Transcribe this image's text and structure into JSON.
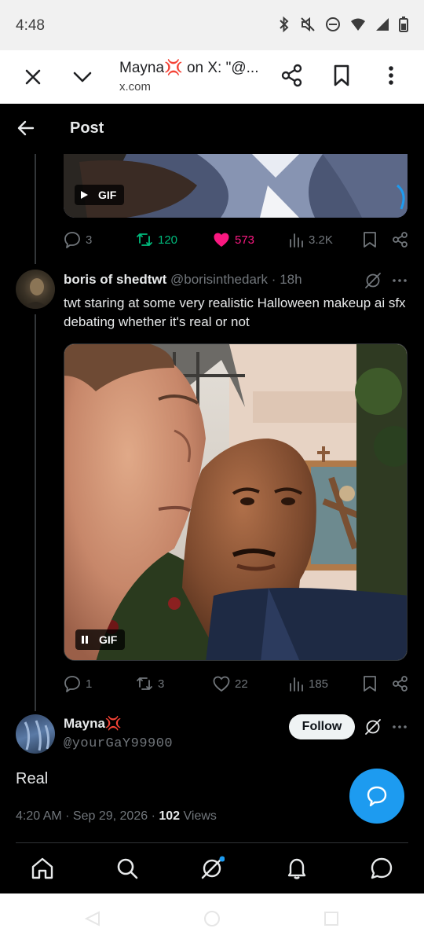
{
  "status_bar": {
    "time": "4:48"
  },
  "browser": {
    "title": "Mayna💢 on X: \"@...",
    "url": "x.com"
  },
  "header": {
    "title": "Post"
  },
  "top_gif": {
    "badge": "GIF"
  },
  "top_actions": {
    "replies": "3",
    "reposts": "120",
    "likes": "573",
    "views": "3.2K"
  },
  "reply_tweet": {
    "name": "boris of shedtwt",
    "handle": "@borisinthedark",
    "sep": "·",
    "time": "18h",
    "text": "twt staring at some very realistic Halloween makeup ai sfx debating whether it's real or not",
    "gif_badge": "GIF",
    "replies": "1",
    "reposts": "3",
    "likes": "22",
    "views": "185"
  },
  "main_tweet": {
    "name": "Mayna💢",
    "handle": "@yourGaY99900",
    "follow_label": "Follow",
    "text": "Real",
    "timestamp": "4:20 AM · Sep 29, 2026 · ",
    "views_count": "102",
    "views_label": "Views"
  },
  "colors": {
    "accent": "#1d9bf0",
    "like": "#f91880",
    "repost": "#00ba7c",
    "muted": "#71767b"
  }
}
